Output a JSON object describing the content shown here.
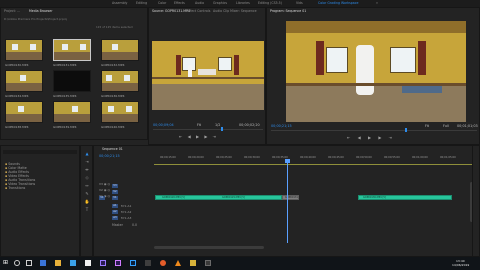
{
  "workspaces": [
    "Assembly",
    "Editing",
    "Color",
    "Effects",
    "Audio",
    "Graphics",
    "Libraries",
    "Editing (CS5.5)",
    "Vids",
    "Color Grading Workspace"
  ],
  "workspace_active_index": 9,
  "project_panel": {
    "tabs": [
      "Project: ...",
      "Media Browser"
    ],
    "path": "D:\\Adobe Premiere Pro Projects\\Project.prproj",
    "items_count": "115 of 125 items selected",
    "clips": [
      {
        "label": "GOPR0130.MP4",
        "meta": "0:30",
        "black": false,
        "selected": false
      },
      {
        "label": "GOPR0131.MP4",
        "meta": "0:14",
        "black": false,
        "selected": true
      },
      {
        "label": "GOPR0132.MP4",
        "meta": "0:09",
        "black": false,
        "selected": false
      },
      {
        "label": "GOPR0134.MP4",
        "meta": "0:21",
        "black": false,
        "selected": false
      },
      {
        "label": "GOPR0135.MP4",
        "meta": "0:05",
        "black": true,
        "selected": false
      },
      {
        "label": "GOPR0136.MP4",
        "meta": "0:11",
        "black": false,
        "selected": false
      },
      {
        "label": "GOPR0138.MP4",
        "meta": "0:07",
        "black": false,
        "selected": false
      },
      {
        "label": "GOPR0139.MP4",
        "meta": "0:12",
        "black": false,
        "selected": false
      },
      {
        "label": "GOPR0140.MP4",
        "meta": "0:08",
        "black": false,
        "selected": false
      }
    ]
  },
  "source_panel": {
    "tabs": [
      "Source: GOPR0131.MP4",
      "Effect Controls",
      "Audio Clip Mixer: Sequence",
      "Metadata"
    ],
    "timecode_in": "00;00;09;04",
    "fit": "Fit",
    "zoom": "1/2",
    "timecode_out": "00;00;02;20"
  },
  "program_panel": {
    "tabs": [
      "Program: Sequence 01"
    ],
    "timecode_in": "00;00;21;15",
    "fit": "Fit",
    "zoom": "Full",
    "timecode_out": "00;01;01;03"
  },
  "bin_panel": {
    "items": [
      "Sounds",
      "Color Matte",
      "Audio Effects",
      "Video Effects",
      "Audio Transitions",
      "Video Transitions",
      "Transitions"
    ]
  },
  "timeline": {
    "tab": "Sequence 01",
    "timecode": "00;00;21;15",
    "ruler": [
      "00;00;15;00",
      "00;00;20;00",
      "00;00;25;00",
      "00;00;30;00",
      "00;00;35;00",
      "00;00;40;00",
      "00;00;45;00",
      "00;00;50;00",
      "00;00;55;00",
      "00;01;00;00",
      "00;01;05;00"
    ],
    "video_tracks": [
      "V3",
      "V2",
      "V1"
    ],
    "audio_tracks": [
      "A1",
      "A2",
      "A3"
    ],
    "master_label": "Master",
    "master_value": "0.0",
    "clip_labels": [
      "GOPR0126.MP4 [V]",
      "GOPR0129.MP4 [V]",
      "GOPR0131",
      "GOPR0136.MP4 [V]"
    ]
  },
  "taskbar": {
    "time": "13:40",
    "date": "14/06/2019"
  },
  "colors": {
    "accent": "#2d8ceb",
    "clip": "#27c59b",
    "wall": "#c7a53a",
    "playhead": "#5aa0ff"
  }
}
